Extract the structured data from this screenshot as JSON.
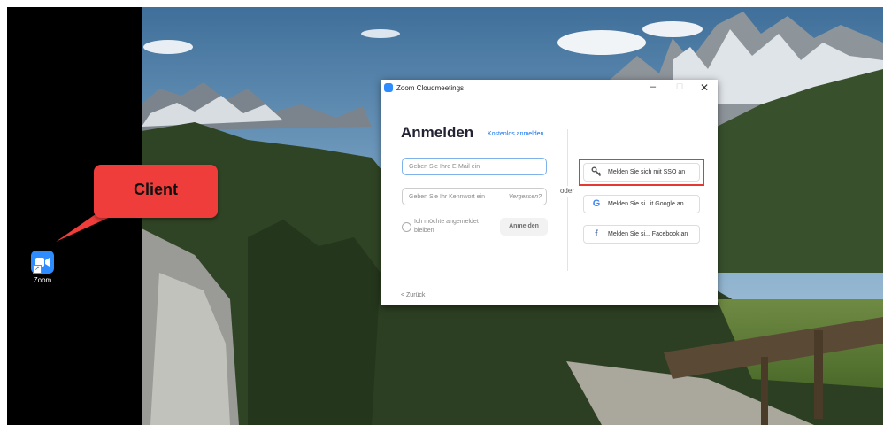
{
  "desktop": {
    "shortcut_label": "Zoom",
    "callout_text": "Client"
  },
  "window": {
    "title": "Zoom Cloudmeetings",
    "controls": {
      "minimize": "–",
      "maximize": "☐",
      "close": "✕"
    }
  },
  "signin": {
    "heading": "Anmelden",
    "signup_link": "Kostenlos anmelden",
    "email_placeholder": "Geben Sie Ihre E-Mail ein",
    "password_placeholder": "Geben Sie Ihr Kennwort ein",
    "forgot_label": "Vergessen?",
    "remember_label": "Ich möchte angemeldet bleiben",
    "login_button": "Anmelden",
    "divider_label": "oder",
    "back_label": "< Zurück"
  },
  "sso_options": [
    {
      "label": "Melden Sie sich mit SSO an",
      "icon": "key-icon"
    },
    {
      "label": "Melden Sie si...it Google an",
      "icon": "google-icon",
      "color": "#4285f4"
    },
    {
      "label": "Melden Sie si... Facebook an",
      "icon": "facebook-icon",
      "color": "#3b5998"
    }
  ],
  "colors": {
    "zoom_blue": "#2d8cff",
    "link_blue": "#0e72ed",
    "callout_red": "#ee3d3a",
    "highlight_red": "#e53935"
  }
}
